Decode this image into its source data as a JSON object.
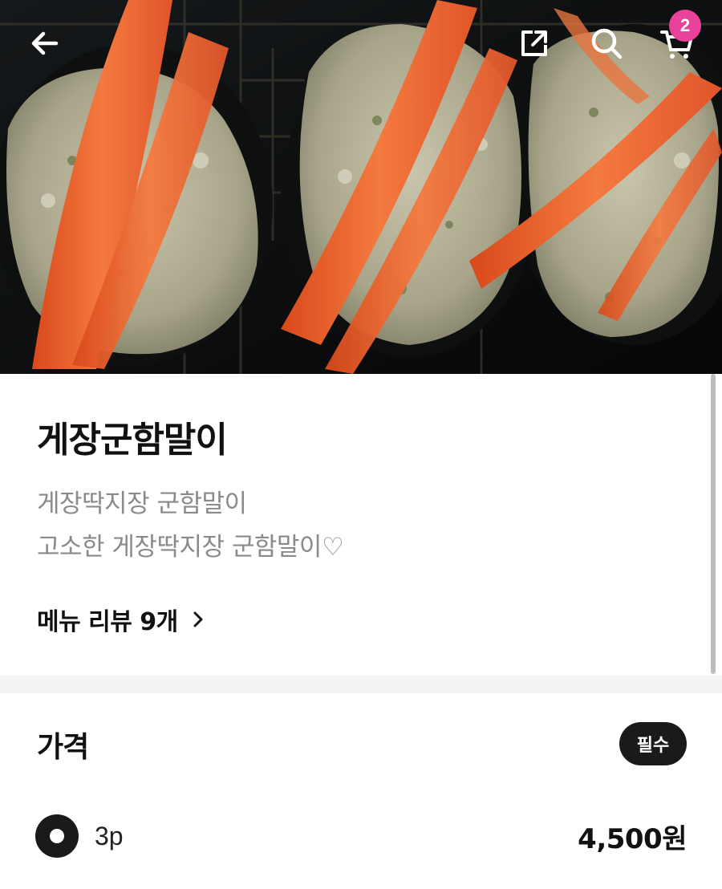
{
  "header": {
    "back_icon": "arrow-left-icon",
    "share_icon": "share-external-icon",
    "search_icon": "search-icon",
    "cart_icon": "cart-icon",
    "cart_count": "2",
    "badge_color": "#e8429a"
  },
  "menu": {
    "name": "게장군함말이",
    "description_line1": "게장딱지장 군함말이",
    "description_line2": "고소한 게장딱지장 군함말이♡",
    "review_link": "메뉴 리뷰 9개"
  },
  "price_section": {
    "title": "가격",
    "required_badge": "필수",
    "options": [
      {
        "label": "3p",
        "price": "4,500원",
        "selected": true
      }
    ]
  }
}
